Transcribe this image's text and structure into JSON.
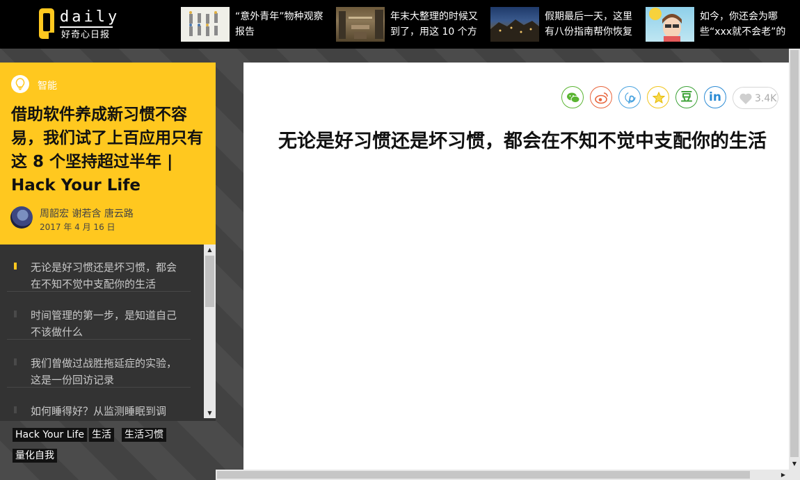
{
  "header": {
    "logo_text": "daily",
    "logo_subtitle": "好奇心日报",
    "news": [
      {
        "title": "“意外青年”物种观察报告",
        "thumb": "figures-illustration"
      },
      {
        "title": "年末大整理的时候又到了，用这 10 个方",
        "thumb": "market-street-photo"
      },
      {
        "title": "假期最后一天，这里有八份指南帮你恢复",
        "thumb": "night-town-photo"
      },
      {
        "title": "如今，你还会为哪些“xxx就不会老”的真",
        "thumb": "woman-sunglasses-illustration"
      }
    ]
  },
  "sidebar": {
    "category": "智能",
    "category_icon": "lightbulb-icon",
    "article_title": "借助软件养成新习惯不容易，我们试了上百应用只有这 8 个坚持超过半年 | Hack Your Life",
    "authors": "周韶宏 谢若含 唐云路",
    "date": "2017 年 4 月 16 日",
    "toc": [
      {
        "text": "无论是好习惯还是坏习惯，都会在不知不觉中支配你的生活",
        "active": true
      },
      {
        "text": "时间管理的第一步，是知道自己不该做什么",
        "active": false
      },
      {
        "text": "我们曾做过战胜拖延症的实验，这是一份回访记录",
        "active": false
      },
      {
        "text": "如何睡得好？从监测睡眠到调",
        "active": false
      }
    ],
    "tags": [
      "Hack Your Life",
      "生活",
      "生活习惯",
      "量化自我"
    ]
  },
  "main": {
    "share": [
      {
        "icon": "wechat-icon",
        "color": "#5bb532"
      },
      {
        "icon": "weibo-icon",
        "color": "#e8643b"
      },
      {
        "icon": "pinterest-icon",
        "color": "#4aa3df"
      },
      {
        "icon": "star-icon",
        "color": "#f0c419"
      },
      {
        "icon": "douban-icon",
        "color": "#3ba135"
      },
      {
        "icon": "linkedin-icon",
        "color": "#2a8ad4"
      }
    ],
    "douban_glyph": "豆",
    "linkedin_glyph": "in",
    "like_count": "3.4K",
    "section_heading": "无论是好习惯还是坏习惯，都会在不知不觉中支配你的生活"
  },
  "colors": {
    "brand_yellow": "#ffc81f",
    "topbar_bg": "#000000",
    "toc_bg": "#333333"
  }
}
